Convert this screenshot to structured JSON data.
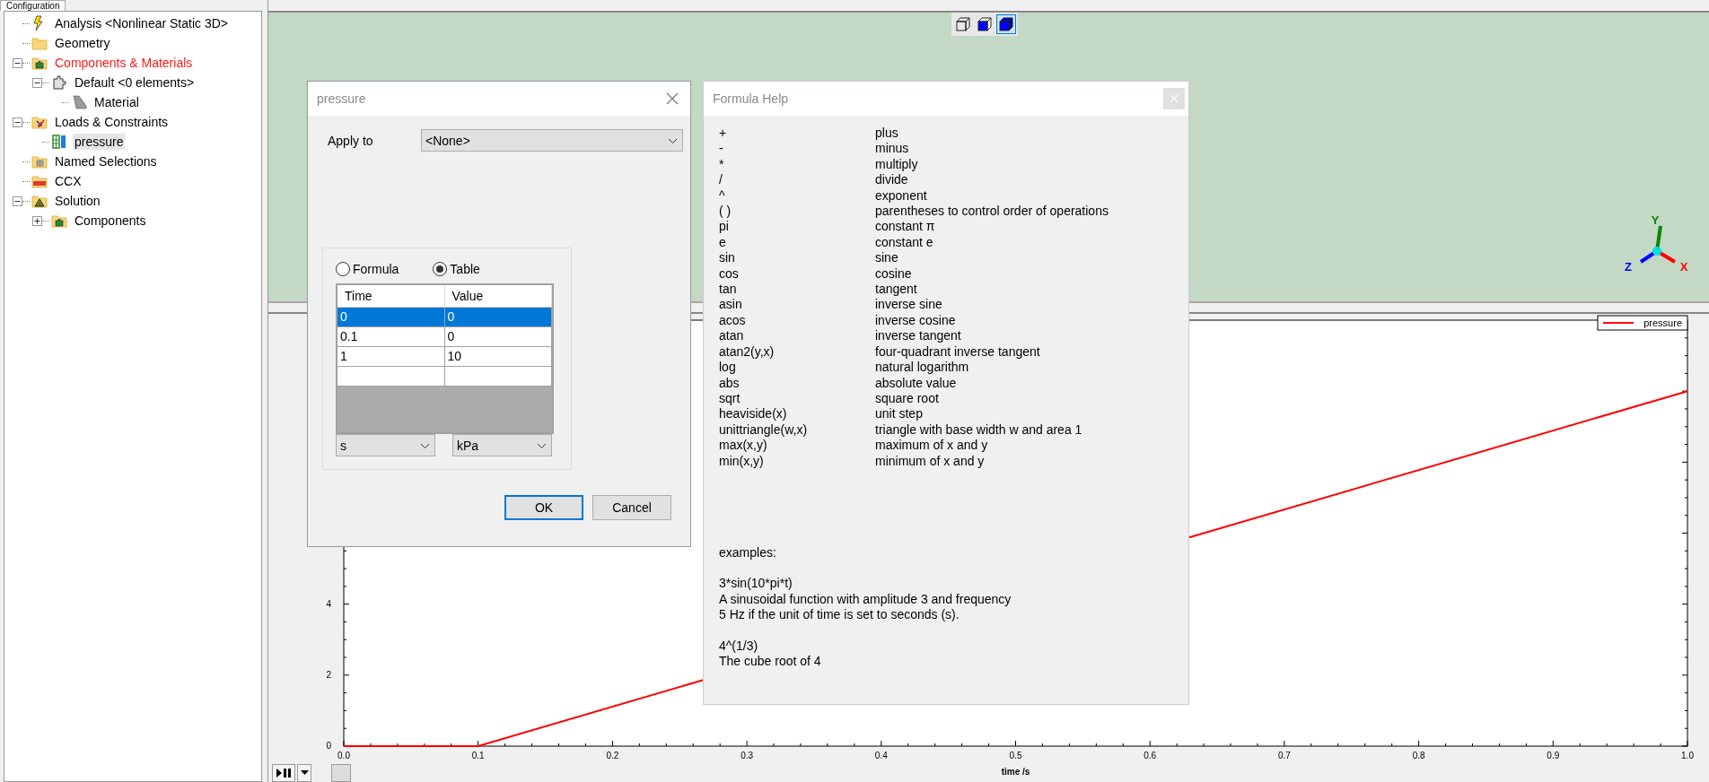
{
  "tab": {
    "label": "Configuration"
  },
  "tree": {
    "items": [
      {
        "label": "Analysis <Nonlinear Static 3D>",
        "kind": "lightning",
        "color": "#000000",
        "selected": false
      },
      {
        "label": "Geometry",
        "kind": "folder",
        "color": "#000000",
        "selected": false
      },
      {
        "label": "Components & Materials",
        "kind": "parts-folder",
        "color": "#ff1a1a",
        "selected": false,
        "expanded": true,
        "children": [
          {
            "label": "Default <0 elements>",
            "kind": "puzzle",
            "color": "#000000",
            "selected": false,
            "expanded": true,
            "children": [
              {
                "label": "Material",
                "kind": "material",
                "color": "#000000",
                "selected": false
              }
            ]
          }
        ]
      },
      {
        "label": "Loads & Constraints",
        "kind": "loads-folder",
        "color": "#000000",
        "selected": false,
        "expanded": true,
        "children": [
          {
            "label": "pressure",
            "kind": "grid",
            "color": "#000000",
            "selected": true
          }
        ]
      },
      {
        "label": "Named Selections",
        "kind": "selection-folder",
        "color": "#000000",
        "selected": false
      },
      {
        "label": "CCX",
        "kind": "solver-folder",
        "color": "#000000",
        "selected": false
      },
      {
        "label": "Solution",
        "kind": "result-folder",
        "color": "#000000",
        "selected": false,
        "expanded": true,
        "children": [
          {
            "label": "Components",
            "kind": "parts-folder",
            "color": "#000000",
            "selected": false,
            "expanded": false
          }
        ]
      }
    ]
  },
  "viewport": {
    "view_buttons": [
      {
        "kind": "wireframe",
        "selected": false
      },
      {
        "kind": "shaded-edges",
        "selected": false
      },
      {
        "kind": "shaded",
        "selected": true
      }
    ],
    "axes": [
      {
        "label": "X",
        "color": "#ff0000"
      },
      {
        "label": "Y",
        "color": "#008800"
      },
      {
        "label": "Z",
        "color": "#0000ff"
      }
    ]
  },
  "pressure_dialog": {
    "title": "pressure",
    "apply_to": {
      "label": "Apply to",
      "value": "<None>"
    },
    "modes": [
      {
        "label": "Formula",
        "selected": false
      },
      {
        "label": "Table",
        "selected": true
      }
    ],
    "table": {
      "columns": [
        "Time",
        "Value"
      ],
      "rows": [
        {
          "cells": [
            "0",
            "0"
          ],
          "selected": true
        },
        {
          "cells": [
            "0.1",
            "0"
          ],
          "selected": false
        },
        {
          "cells": [
            "1",
            "10"
          ],
          "selected": false
        }
      ]
    },
    "units": [
      "s",
      "kPa"
    ],
    "buttons": [
      {
        "label": "OK",
        "default": true
      },
      {
        "label": "Cancel",
        "default": false
      }
    ]
  },
  "formula_help": {
    "title": "Formula Help",
    "entries": [
      {
        "symbol": "+",
        "meaning": "plus"
      },
      {
        "symbol": "-",
        "meaning": "minus"
      },
      {
        "symbol": "*",
        "meaning": "multiply"
      },
      {
        "symbol": "/",
        "meaning": "divide"
      },
      {
        "symbol": "^",
        "meaning": "exponent"
      },
      {
        "symbol": "( )",
        "meaning": "parentheses to control order of operations"
      },
      {
        "symbol": "pi",
        "meaning": "constant π"
      },
      {
        "symbol": "e",
        "meaning": "constant e"
      },
      {
        "symbol": "sin",
        "meaning": "sine"
      },
      {
        "symbol": "cos",
        "meaning": "cosine"
      },
      {
        "symbol": "tan",
        "meaning": "tangent"
      },
      {
        "symbol": "asin",
        "meaning": "inverse sine"
      },
      {
        "symbol": "acos",
        "meaning": "inverse cosine"
      },
      {
        "symbol": "atan",
        "meaning": "inverse tangent"
      },
      {
        "symbol": "atan2(y,x)",
        "meaning": "four-quadrant inverse tangent"
      },
      {
        "symbol": "log",
        "meaning": "natural logarithm"
      },
      {
        "symbol": "abs",
        "meaning": "absolute value"
      },
      {
        "symbol": "sqrt",
        "meaning": "square root"
      },
      {
        "symbol": "heaviside(x)",
        "meaning": "unit step"
      },
      {
        "symbol": "unittriangle(w,x)",
        "meaning": "triangle with base width w and area 1"
      },
      {
        "symbol": "max(x,y)",
        "meaning": "maximum of x and y"
      },
      {
        "symbol": "min(x,y)",
        "meaning": "minimum of x and y"
      }
    ],
    "examples_heading": "examples:",
    "examples": [
      {
        "formula": "3*sin(10*pi*t)",
        "description": [
          "A sinusoidal function with amplitude 3 and frequency",
          "5 Hz if the unit of time is set to seconds (s)."
        ]
      },
      {
        "formula": "4^(1/3)",
        "description": [
          "The cube root of 4"
        ]
      }
    ]
  },
  "chart": {
    "chart_data": {
      "type": "line",
      "xlabel": "time /s",
      "x": [
        0,
        0.1,
        1
      ],
      "series": [
        {
          "name": "pressure",
          "color": "#ff0000",
          "values": [
            0,
            0,
            10
          ]
        }
      ],
      "xlim": [
        0,
        1
      ],
      "ylim": [
        0,
        12
      ],
      "xticks": [
        {
          "value": 0,
          "label": "0.0"
        },
        {
          "value": 0.1,
          "label": "0.1"
        },
        {
          "value": 0.2,
          "label": "0.2"
        },
        {
          "value": 0.3,
          "label": "0.3"
        },
        {
          "value": 0.4,
          "label": "0.4"
        },
        {
          "value": 0.5,
          "label": "0.5"
        },
        {
          "value": 0.6,
          "label": "0.6"
        },
        {
          "value": 0.7,
          "label": "0.7"
        },
        {
          "value": 0.8,
          "label": "0.8"
        },
        {
          "value": 0.9,
          "label": "0.9"
        },
        {
          "value": 1,
          "label": "1.0"
        }
      ],
      "yticks": [
        0,
        2,
        4
      ]
    }
  }
}
